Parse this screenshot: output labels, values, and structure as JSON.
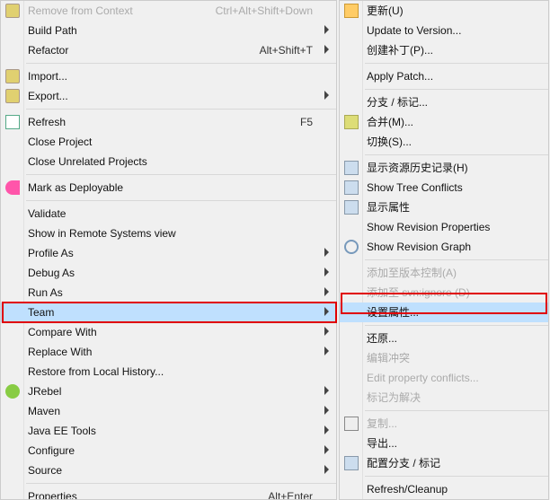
{
  "left_menu": {
    "remove_context": "Remove from Context",
    "remove_context_key": "Ctrl+Alt+Shift+Down",
    "build_path": "Build Path",
    "refactor": "Refactor",
    "refactor_key": "Alt+Shift+T",
    "import": "Import...",
    "export": "Export...",
    "refresh": "Refresh",
    "refresh_key": "F5",
    "close_project": "Close Project",
    "close_unrelated": "Close Unrelated Projects",
    "mark_deploy": "Mark as Deployable",
    "validate": "Validate",
    "show_remote": "Show in Remote Systems view",
    "profile_as": "Profile As",
    "debug_as": "Debug As",
    "run_as": "Run As",
    "team": "Team",
    "compare_with": "Compare With",
    "replace_with": "Replace With",
    "restore_history": "Restore from Local History...",
    "jrebel": "JRebel",
    "maven": "Maven",
    "javaee": "Java EE Tools",
    "configure": "Configure",
    "source": "Source",
    "properties": "Properties",
    "properties_key": "Alt+Enter"
  },
  "right_menu": {
    "update_u": "更新(U)",
    "update_version": "Update to Version...",
    "create_patch": "创建补丁(P)...",
    "apply_patch": "Apply Patch...",
    "branch_tag": "分支 / 标记...",
    "merge_m": "合并(M)...",
    "switch_s": "切换(S)...",
    "show_history": "显示资源历史记录(H)",
    "show_tree_conflicts": "Show Tree Conflicts",
    "show_props": "显示属性",
    "show_rev_props": "Show Revision Properties",
    "show_rev_graph": "Show Revision Graph",
    "add_vc": "添加至版本控制(A)",
    "add_ignore": "添加至 svn:ignore (D)",
    "set_props": "设置属性...",
    "revert": "还原...",
    "edit_conflicts": "编辑冲突",
    "edit_prop_conflicts": "Edit property conflicts...",
    "mark_resolved": "标记为解决",
    "copy": "复制...",
    "export": "导出...",
    "config_branch": "配置分支 / 标记",
    "refresh_cleanup": "Refresh/Cleanup"
  }
}
